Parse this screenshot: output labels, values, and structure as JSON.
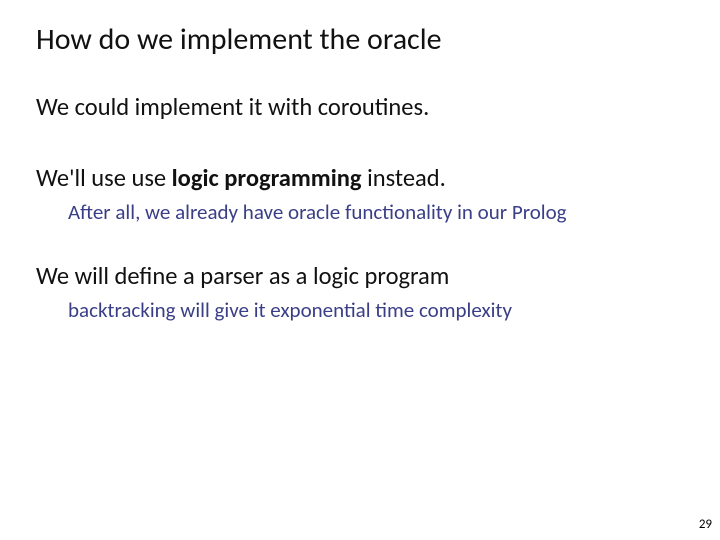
{
  "title": "How do we implement the oracle",
  "p1": "We could implement it with coroutines.",
  "p2_pre": "We'll use use ",
  "p2_bold": "logic programming",
  "p2_post": " instead.",
  "sub2": "After all, we already have oracle functionality in our Prolog",
  "p3": "We will define a parser as a logic program",
  "sub3": "backtracking will give it exponential time complexity",
  "page_number": "29"
}
